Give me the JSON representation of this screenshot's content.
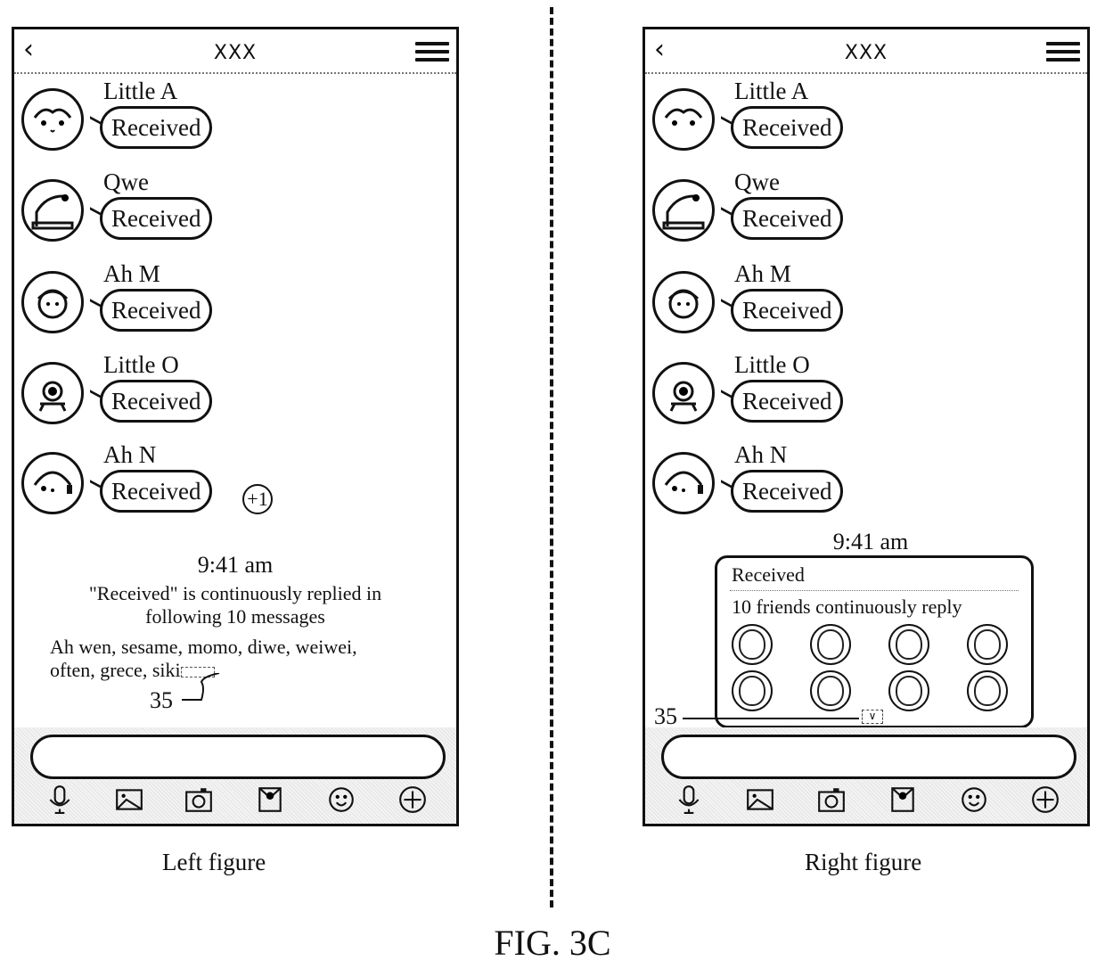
{
  "figure_label": "FIG. 3C",
  "captions": {
    "left": "Left figure",
    "right": "Right figure"
  },
  "left": {
    "header": {
      "back_icon": "chevron-left-icon",
      "title": "XXX",
      "menu_icon": "hamburger-menu-icon"
    },
    "messages": [
      {
        "sender": "Little A",
        "text": "Received",
        "avatar": "girl-avatar"
      },
      {
        "sender": "Qwe",
        "text": "Received",
        "avatar": "penguin-avatar"
      },
      {
        "sender": "Ah M",
        "text": "Received",
        "avatar": "boy-avatar"
      },
      {
        "sender": "Little O",
        "text": "Received",
        "avatar": "one-eyed-monster-avatar"
      },
      {
        "sender": "Ah N",
        "text": "Received",
        "avatar": "headphone-kid-avatar",
        "badge": "+1"
      }
    ],
    "time": "9:41 am",
    "summary_line1": "\"Received\" is continuously replied in",
    "summary_line2": "following 10 messages",
    "names_line1": "Ah wen, sesame, momo, diwe, weiwei,",
    "names_line2": "often, grece, siki",
    "reference_numeral": "35",
    "input_value": "",
    "toolbar": [
      "microphone-icon",
      "image-icon",
      "camera-icon",
      "red-envelope-icon",
      "emoji-icon",
      "plus-icon"
    ]
  },
  "right": {
    "header": {
      "back_icon": "chevron-left-icon",
      "title": "XXX",
      "menu_icon": "hamburger-menu-icon"
    },
    "messages": [
      {
        "sender": "Little A",
        "text": "Received",
        "avatar": "girl-avatar"
      },
      {
        "sender": "Qwe",
        "text": "Received",
        "avatar": "penguin-avatar"
      },
      {
        "sender": "Ah M",
        "text": "Received",
        "avatar": "boy-avatar"
      },
      {
        "sender": "Little O",
        "text": "Received",
        "avatar": "one-eyed-monster-avatar"
      },
      {
        "sender": "Ah N",
        "text": "Received",
        "avatar": "headphone-kid-avatar"
      }
    ],
    "time": "9:41 am",
    "card": {
      "title": "Received",
      "subtitle": "10 friends continuously reply",
      "friend_avatars_shown": 8,
      "expand_icon": "chevron-down-icon"
    },
    "reference_numeral": "35",
    "input_value": "",
    "toolbar": [
      "microphone-icon",
      "image-icon",
      "camera-icon",
      "red-envelope-icon",
      "emoji-icon",
      "plus-icon"
    ]
  }
}
